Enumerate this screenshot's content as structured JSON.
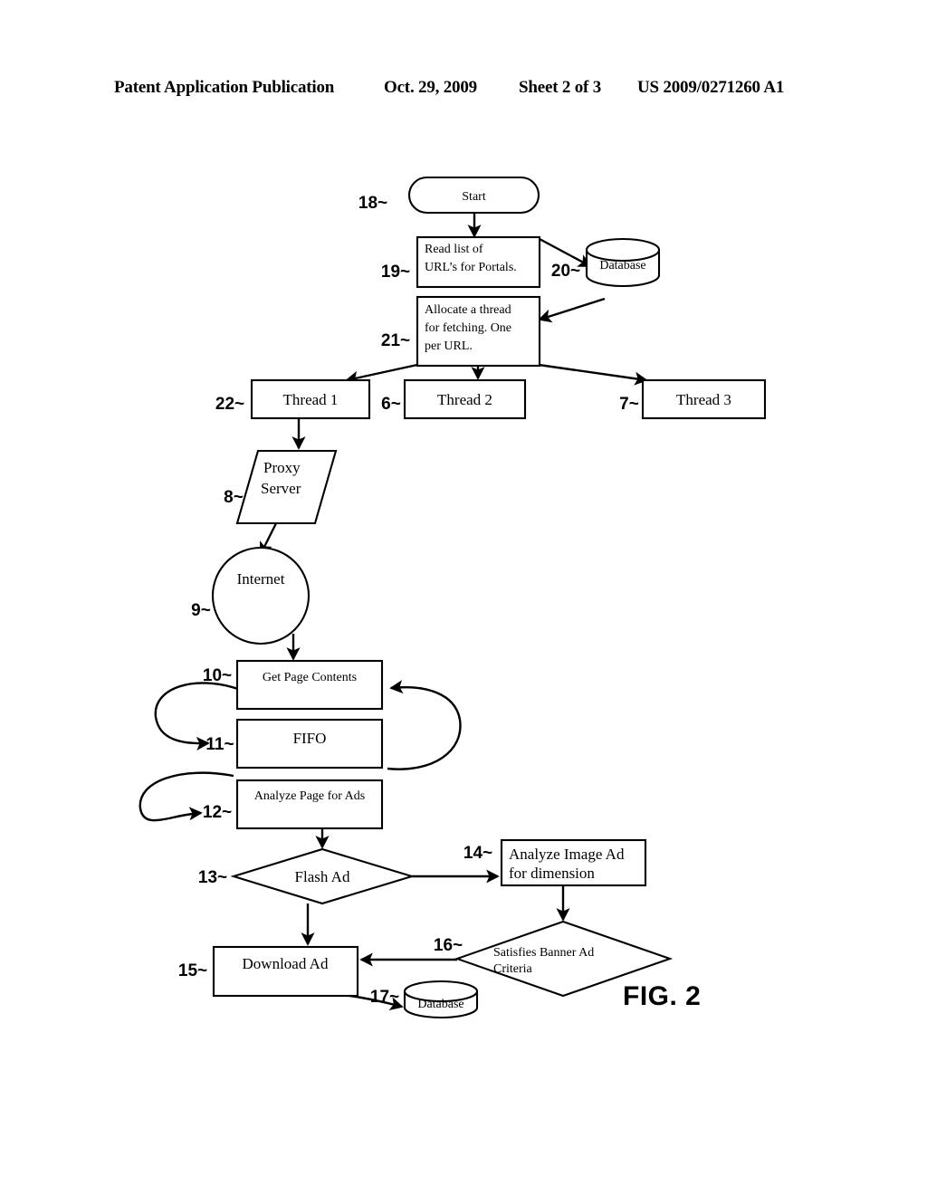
{
  "header": {
    "publication": "Patent Application Publication",
    "date": "Oct. 29, 2009",
    "sheet": "Sheet 2 of 3",
    "patent_number": "US 2009/0271260 A1"
  },
  "figure": {
    "label": "FIG. 2",
    "nodes": [
      {
        "id": "start",
        "ref": "18~",
        "text": "Start",
        "shape": "terminator"
      },
      {
        "id": "read_urls",
        "ref": "19~",
        "text_line1": "Read list of",
        "text_line2": "URL’s for Portals.",
        "shape": "process"
      },
      {
        "id": "database_top",
        "ref": "20~",
        "text": "Database",
        "shape": "cylinder"
      },
      {
        "id": "allocate",
        "ref": "21~",
        "text_line1": "Allocate a thread",
        "text_line2": "for fetching. One",
        "text_line3": "per URL.",
        "shape": "process"
      },
      {
        "id": "thread1",
        "ref": "22~",
        "text": "Thread 1",
        "shape": "process"
      },
      {
        "id": "thread2",
        "ref": "6~",
        "text": "Thread 2",
        "shape": "process"
      },
      {
        "id": "thread3",
        "ref": "7~",
        "text": "Thread 3",
        "shape": "process"
      },
      {
        "id": "proxy",
        "ref": "8~",
        "text_line1": "Proxy",
        "text_line2": "Server",
        "shape": "parallelogram"
      },
      {
        "id": "internet",
        "ref": "9~",
        "text": "Internet",
        "shape": "circle"
      },
      {
        "id": "get_page",
        "ref": "10~",
        "text": "Get Page Contents",
        "shape": "process"
      },
      {
        "id": "fifo",
        "ref": "11~",
        "text": "FIFO",
        "shape": "process"
      },
      {
        "id": "analyze_page",
        "ref": "12~",
        "text": "Analyze Page for Ads",
        "shape": "process"
      },
      {
        "id": "flash_ad",
        "ref": "13~",
        "text": "Flash Ad",
        "shape": "decision"
      },
      {
        "id": "analyze_img",
        "ref": "14~",
        "text_line1": "Analyze Image Ad",
        "text_line2": "for dimension",
        "shape": "process"
      },
      {
        "id": "download_ad",
        "ref": "15~",
        "text": "Download Ad",
        "shape": "process"
      },
      {
        "id": "satisfies",
        "ref": "16~",
        "text_line1": "Satisfies Banner Ad",
        "text_line2": "Criteria",
        "shape": "decision"
      },
      {
        "id": "database_bot",
        "ref": "17~",
        "text": "Database",
        "shape": "cylinder"
      }
    ]
  },
  "colors": {
    "ink": "#000000",
    "paper": "#ffffff"
  }
}
